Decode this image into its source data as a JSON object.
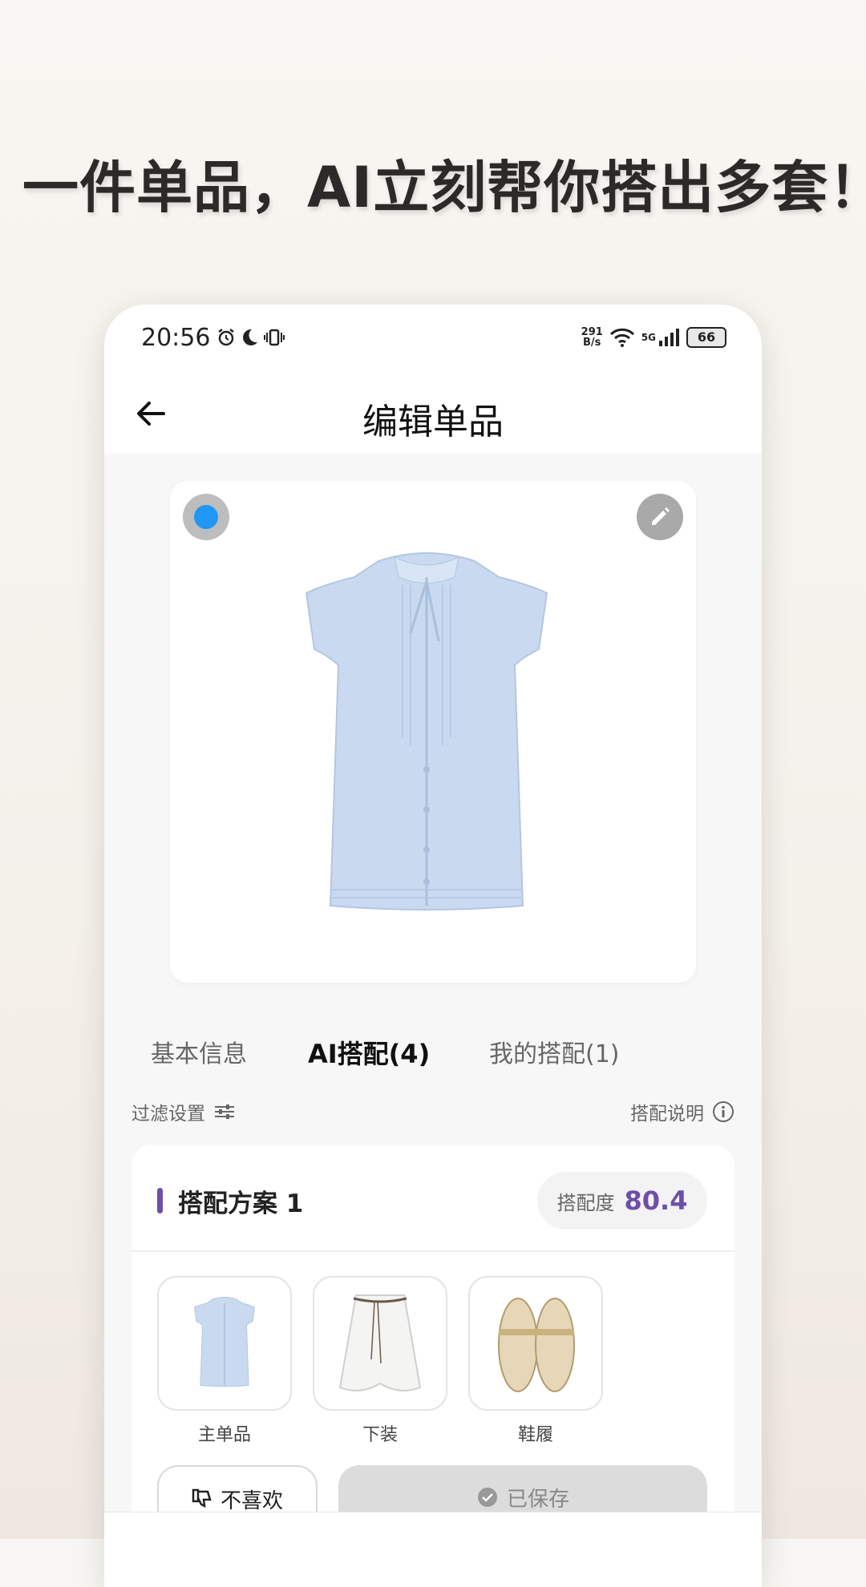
{
  "headline": "一件单品，AI立刻帮你搭出多套！",
  "status_bar": {
    "time": "20:56",
    "net_speed_value": "291",
    "net_speed_unit": "B/s",
    "network": "5G",
    "battery": "66"
  },
  "header": {
    "title": "编辑单品",
    "back_icon": "arrow-left-icon"
  },
  "image_card": {
    "selected": true,
    "edit_icon": "pencil-icon"
  },
  "tabs": [
    {
      "label": "基本信息",
      "active": false
    },
    {
      "label": "AI搭配(4)",
      "active": true
    },
    {
      "label": "我的搭配(1)",
      "active": false
    }
  ],
  "filter": {
    "left_label": "过滤设置",
    "right_label": "搭配说明"
  },
  "plan": {
    "title": "搭配方案 1",
    "score_label": "搭配度",
    "score_value": "80.4",
    "items": [
      {
        "label": "主单品"
      },
      {
        "label": "下装"
      },
      {
        "label": "鞋履"
      }
    ],
    "dislike_label": "不喜欢",
    "saved_label": "已保存"
  },
  "colors": {
    "accent": "#6d4fa8",
    "radio_blue": "#2196f3",
    "shirt_blue": "#c9daf0"
  }
}
